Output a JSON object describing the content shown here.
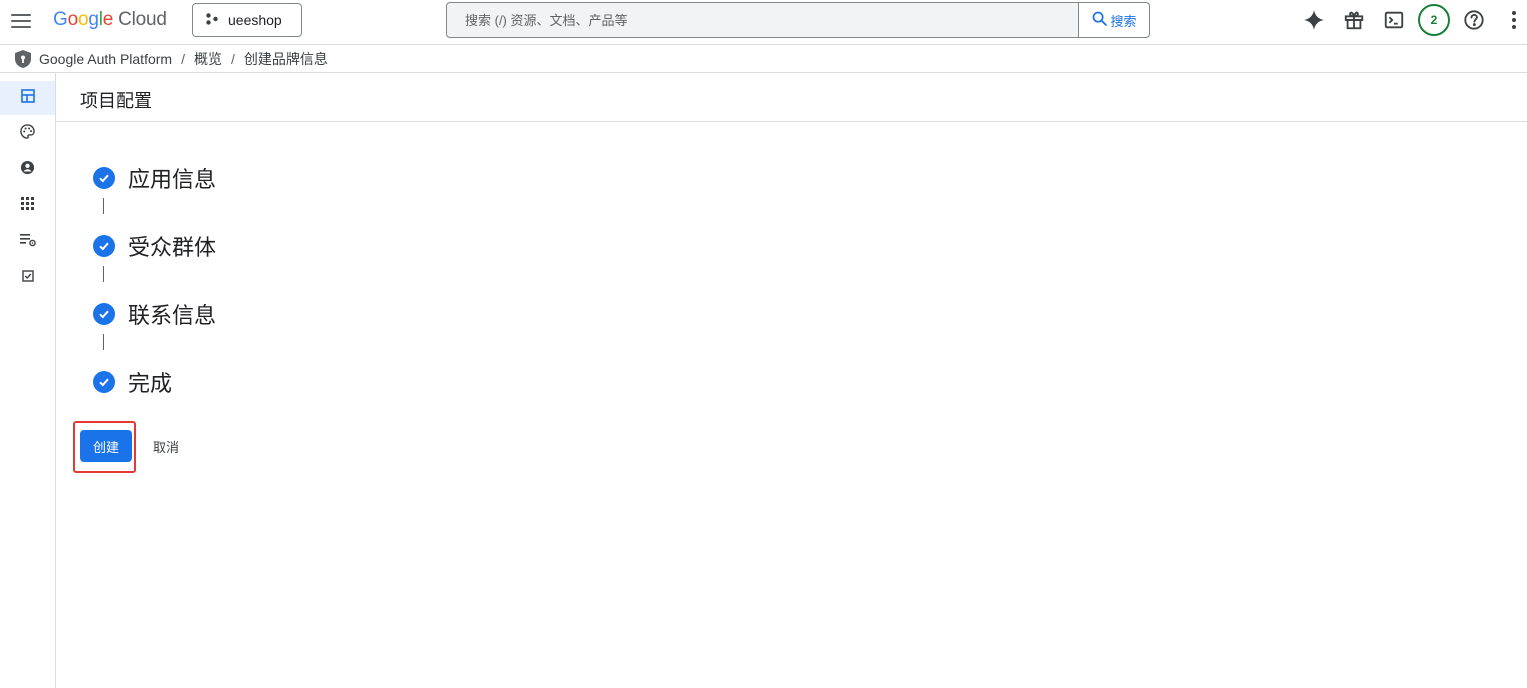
{
  "topbar": {
    "logo_google": "Google",
    "logo_cloud": "Cloud",
    "project_name": "ueeshop",
    "search_placeholder": "搜索 (/) 资源、文档、产品等",
    "search_button_label": "搜索",
    "notification_count": "2"
  },
  "breadcrumb": {
    "items": [
      "Google Auth Platform",
      "概览",
      "创建品牌信息"
    ],
    "separator": "/"
  },
  "page": {
    "title": "项目配置"
  },
  "steps": [
    {
      "label": "应用信息",
      "status": "complete"
    },
    {
      "label": "受众群体",
      "status": "complete"
    },
    {
      "label": "联系信息",
      "status": "complete"
    },
    {
      "label": "完成",
      "status": "complete"
    }
  ],
  "actions": {
    "create_label": "创建",
    "cancel_label": "取消"
  },
  "colors": {
    "primary": "#1a73e8",
    "highlight": "#e53935",
    "badge": "#188038"
  }
}
